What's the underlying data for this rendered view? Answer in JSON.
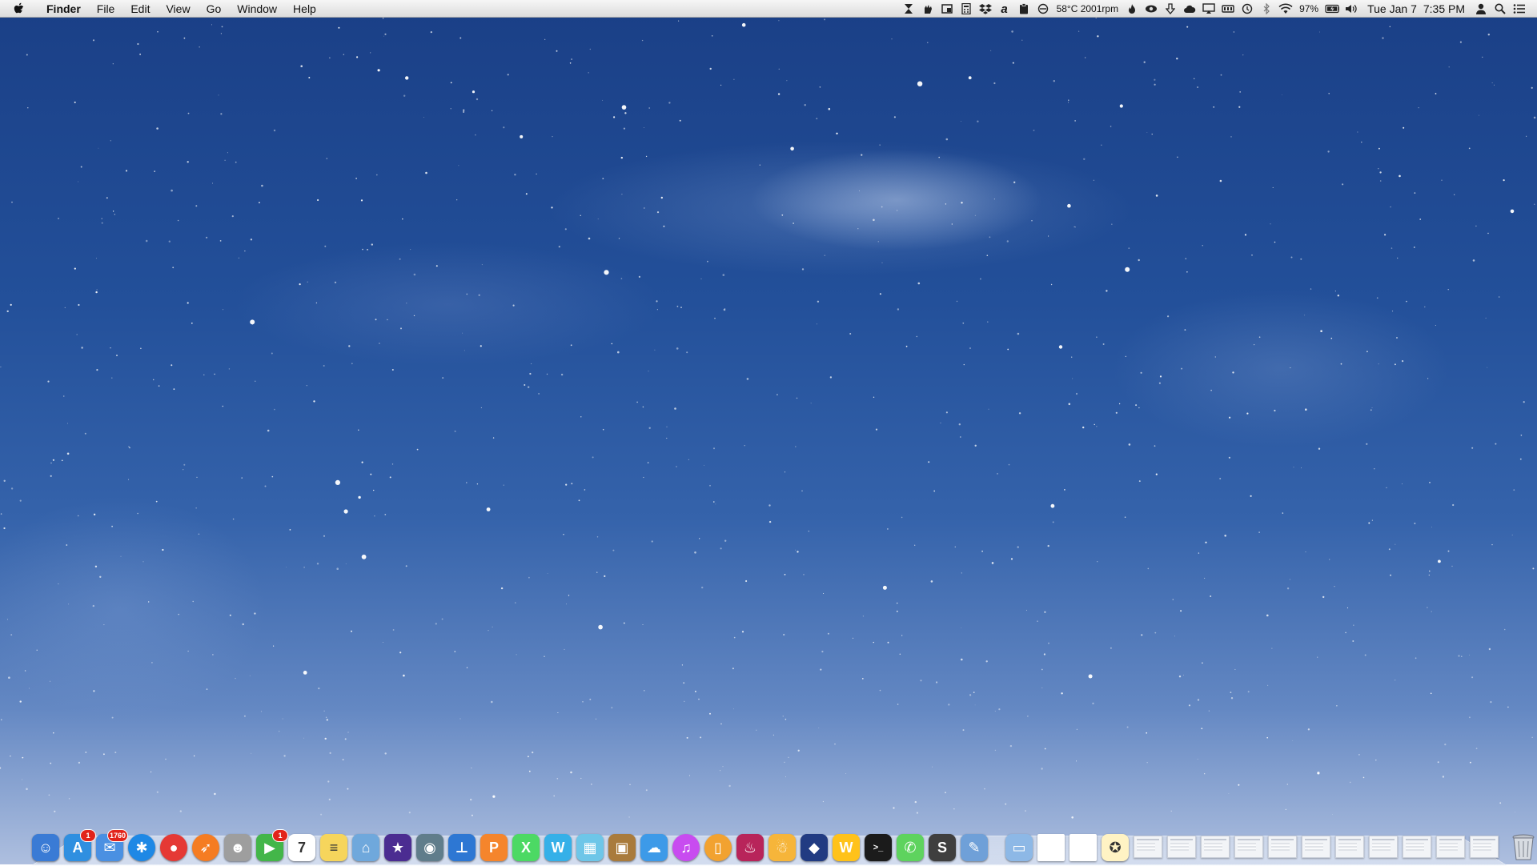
{
  "menubar": {
    "app_name": "Finder",
    "menus": [
      "File",
      "Edit",
      "View",
      "Go",
      "Window",
      "Help"
    ],
    "status": {
      "temperature_fan": "58°C 2001rpm",
      "battery_percent": "97%",
      "date": "Tue Jan 7",
      "time": "7:35 PM"
    }
  },
  "dock": {
    "apps": [
      {
        "name": "Finder",
        "glyph": "☺",
        "color": "#3a7bd5"
      },
      {
        "name": "App Store",
        "glyph": "A",
        "color": "#2f8fe0",
        "badge": "1"
      },
      {
        "name": "Mail",
        "glyph": "✉",
        "color": "#4a90e2",
        "badge": "1760"
      },
      {
        "name": "Safari",
        "glyph": "✱",
        "color": "#1e88e5"
      },
      {
        "name": "Chrome",
        "glyph": "●",
        "color": "#e53935"
      },
      {
        "name": "Rocket",
        "glyph": "➶",
        "color": "#f57c22"
      },
      {
        "name": "Contacts",
        "glyph": "☻",
        "color": "#9e9e9e"
      },
      {
        "name": "FaceTime",
        "glyph": "▶",
        "color": "#43b649",
        "badge": "1"
      },
      {
        "name": "Calendar",
        "glyph": "7",
        "color": "#ffffff"
      },
      {
        "name": "Notes",
        "glyph": "≡",
        "color": "#f6d55c"
      },
      {
        "name": "Preview",
        "glyph": "⌂",
        "color": "#6fa8dc"
      },
      {
        "name": "iMovie",
        "glyph": "★",
        "color": "#4b2c91"
      },
      {
        "name": "Image Capture",
        "glyph": "◉",
        "color": "#607d8b"
      },
      {
        "name": "Keynote",
        "glyph": "⊥",
        "color": "#2d77d3"
      },
      {
        "name": "Pages",
        "glyph": "P",
        "color": "#f5852c"
      },
      {
        "name": "Numbers",
        "glyph": "X",
        "color": "#4cd964"
      },
      {
        "name": "Word",
        "glyph": "W",
        "color": "#35b0e8"
      },
      {
        "name": "Final Cut",
        "glyph": "▦",
        "color": "#6ec6e8"
      },
      {
        "name": "Archive Utility",
        "glyph": "▣",
        "color": "#a97b3c"
      },
      {
        "name": "Cloud",
        "glyph": "☁",
        "color": "#3d9ae8"
      },
      {
        "name": "iTunes",
        "glyph": "♫",
        "color": "#c84cf0"
      },
      {
        "name": "iBooks",
        "glyph": "▯",
        "color": "#f2a230"
      },
      {
        "name": "Flame",
        "glyph": "♨",
        "color": "#b8245a"
      },
      {
        "name": "Snowman",
        "glyph": "☃",
        "color": "#f6b53a"
      },
      {
        "name": "Dashboard",
        "glyph": "◆",
        "color": "#213b82"
      },
      {
        "name": "Wunderlist",
        "glyph": "W",
        "color": "#ffc21a"
      },
      {
        "name": "Terminal",
        "glyph": ">_",
        "color": "#1b1b1b"
      },
      {
        "name": "Messages",
        "glyph": "✆",
        "color": "#5ed35e"
      },
      {
        "name": "Sublime Text",
        "glyph": "S",
        "color": "#3f3f3f"
      },
      {
        "name": "Xcode",
        "glyph": "✎",
        "color": "#6fa0d8"
      }
    ],
    "folders": [
      {
        "name": "Folder",
        "glyph": "▭",
        "color": "#8db8e6"
      },
      {
        "name": "Document",
        "glyph": "",
        "color": "#ffffff"
      },
      {
        "name": "Document 2",
        "glyph": "",
        "color": "#ffffff"
      },
      {
        "name": "Cyberduck",
        "glyph": "✪",
        "color": "#fff3c4"
      }
    ],
    "minimized_window_count": 11
  },
  "colors": {
    "menubar_bg": "#e8e8e8",
    "badge": "#e2231a",
    "sky_top": "#1a3f86",
    "sky_bottom": "#aebfdf"
  }
}
